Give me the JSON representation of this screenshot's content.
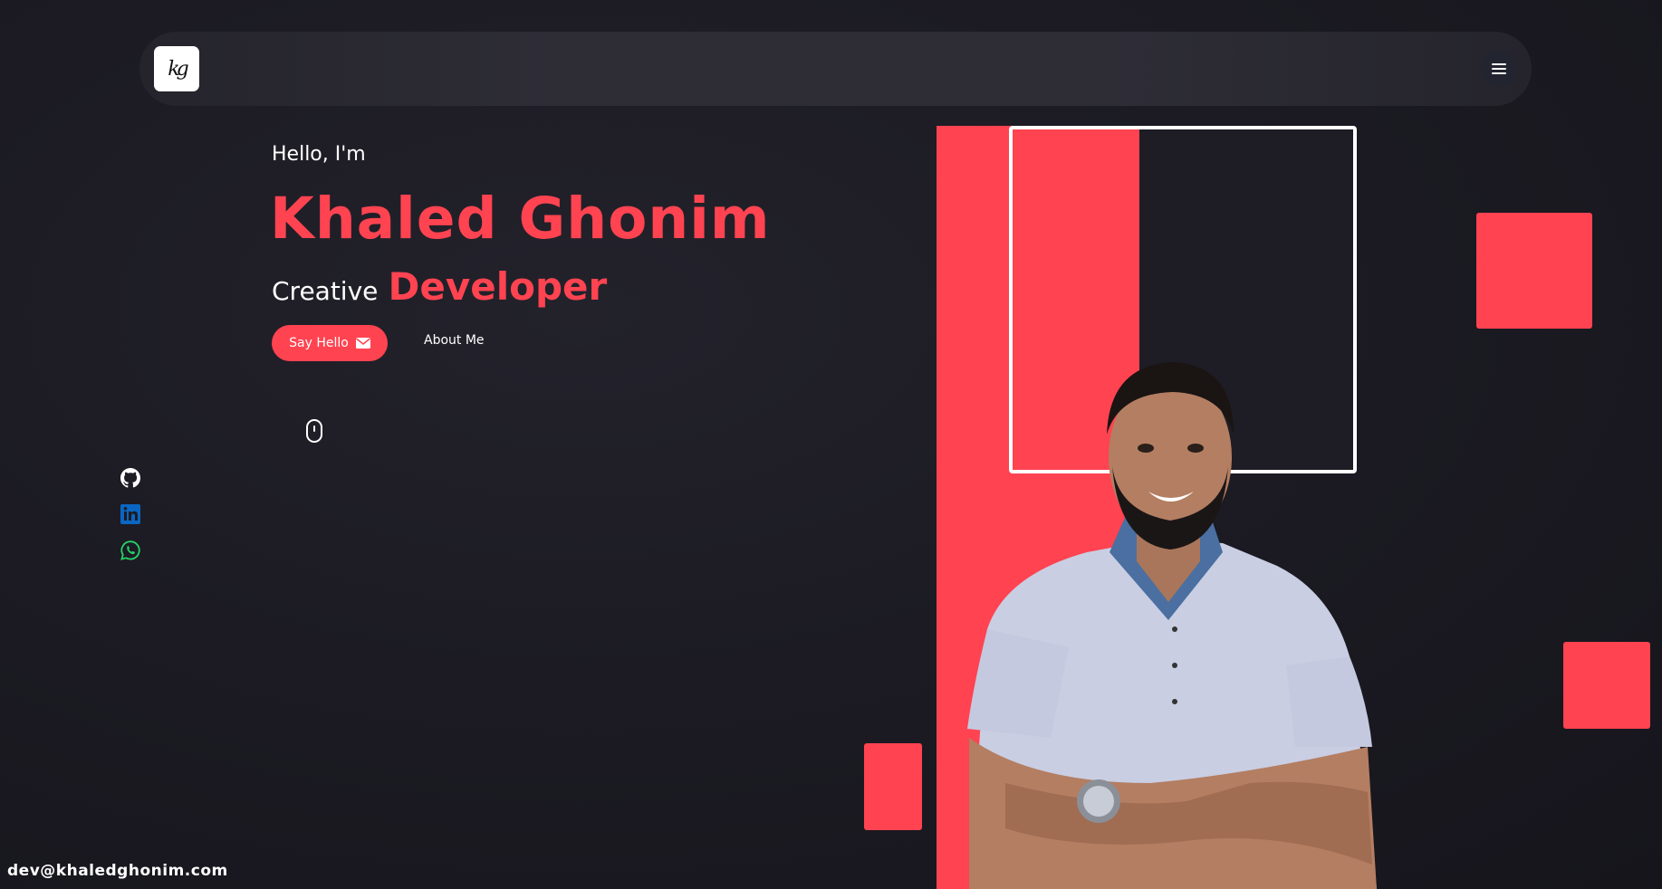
{
  "nav": {
    "logo_text": "kg",
    "logo_icon": "monogram-logo",
    "menu_icon": "hamburger-icon"
  },
  "hero": {
    "greeting": "Hello, I'm",
    "name": "Khaled Ghonim",
    "tagline_static": "Creative",
    "tagline_role": "Developer",
    "say_hello_label": "Say Hello",
    "say_hello_icon": "envelope-icon",
    "about_me_label": "About Me",
    "scroll_icon": "mouse-icon"
  },
  "social": [
    {
      "name": "github-icon",
      "color": "#ffffff"
    },
    {
      "name": "linkedin-icon",
      "color": "#0a66c2"
    },
    {
      "name": "whatsapp-icon",
      "color": "#25d366"
    }
  ],
  "footer": {
    "email": "dev@khaledghonim.com"
  },
  "colors": {
    "accent": "#ff4351",
    "background": "#1c1b23",
    "navbar": "#2e2d36",
    "text": "#ffffff"
  }
}
